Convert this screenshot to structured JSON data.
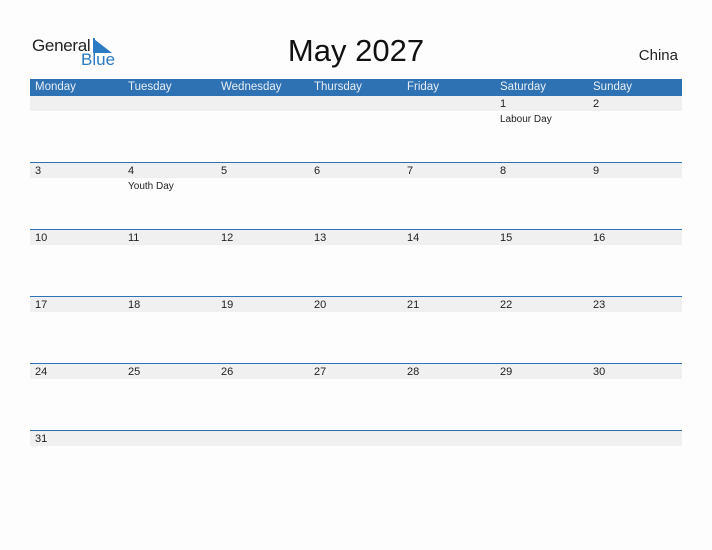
{
  "logo": {
    "text_general": "General",
    "text_blue": "Blue",
    "accent": "#2a7bc4"
  },
  "title": "May 2027",
  "country": "China",
  "header_color": "#2e72b3",
  "weekdays": [
    "Monday",
    "Tuesday",
    "Wednesday",
    "Thursday",
    "Friday",
    "Saturday",
    "Sunday"
  ],
  "weeks": [
    [
      {
        "d": ""
      },
      {
        "d": ""
      },
      {
        "d": ""
      },
      {
        "d": ""
      },
      {
        "d": ""
      },
      {
        "d": "1",
        "ev": "Labour Day"
      },
      {
        "d": "2"
      }
    ],
    [
      {
        "d": "3"
      },
      {
        "d": "4",
        "ev": "Youth Day"
      },
      {
        "d": "5"
      },
      {
        "d": "6"
      },
      {
        "d": "7"
      },
      {
        "d": "8"
      },
      {
        "d": "9"
      }
    ],
    [
      {
        "d": "10"
      },
      {
        "d": "11"
      },
      {
        "d": "12"
      },
      {
        "d": "13"
      },
      {
        "d": "14"
      },
      {
        "d": "15"
      },
      {
        "d": "16"
      }
    ],
    [
      {
        "d": "17"
      },
      {
        "d": "18"
      },
      {
        "d": "19"
      },
      {
        "d": "20"
      },
      {
        "d": "21"
      },
      {
        "d": "22"
      },
      {
        "d": "23"
      }
    ],
    [
      {
        "d": "24"
      },
      {
        "d": "25"
      },
      {
        "d": "26"
      },
      {
        "d": "27"
      },
      {
        "d": "28"
      },
      {
        "d": "29"
      },
      {
        "d": "30"
      }
    ],
    [
      {
        "d": "31"
      },
      {
        "d": ""
      },
      {
        "d": ""
      },
      {
        "d": ""
      },
      {
        "d": ""
      },
      {
        "d": ""
      },
      {
        "d": ""
      }
    ]
  ]
}
